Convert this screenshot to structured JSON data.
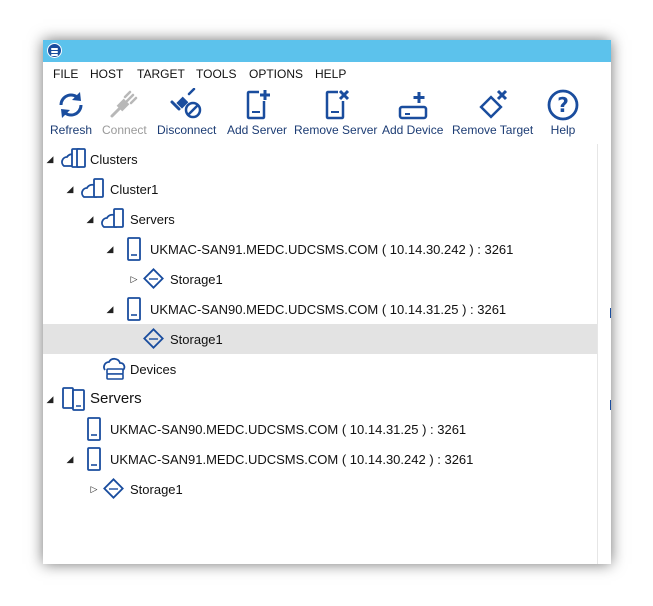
{
  "menu": [
    "FILE",
    "HOST",
    "TARGET",
    "TOOLS",
    "OPTIONS",
    "HELP"
  ],
  "toolbar": {
    "refresh": "Refresh",
    "connect": "Connect",
    "disconnect": "Disconnect",
    "add_server": "Add Server",
    "remove_server": "Remove Server",
    "add_device": "Add Device",
    "remove_target": "Remove Target",
    "help": "Help"
  },
  "tree": {
    "clusters": "Clusters",
    "cluster1": "Cluster1",
    "cluster_servers": "Servers",
    "server_san91": "UKMAC-SAN91.MEDC.UDCSMS.COM ( 10.14.30.242 ) : 3261",
    "storage_a": "Storage1",
    "server_san90": "UKMAC-SAN90.MEDC.UDCSMS.COM ( 10.14.31.25 ) : 3261",
    "storage_b": "Storage1",
    "devices": "Devices",
    "servers_root": "Servers",
    "root_san90": "UKMAC-SAN90.MEDC.UDCSMS.COM ( 10.14.31.25 ) : 3261",
    "root_san91": "UKMAC-SAN91.MEDC.UDCSMS.COM ( 10.14.30.242 ) : 3261",
    "storage_c": "Storage1"
  },
  "colors": {
    "accent": "#1a4d9e",
    "titlebar": "#5cc2ec",
    "selection": "#e3e3e3",
    "disabled": "#9a9a9a"
  }
}
